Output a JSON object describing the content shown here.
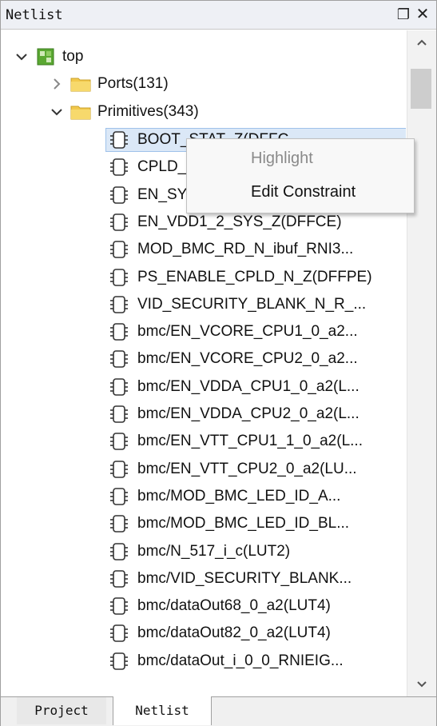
{
  "panel": {
    "title": "Netlist",
    "float_icon": "float-window-icon",
    "close_icon": "close-icon",
    "float_glyph": "❐",
    "close_glyph": "✕"
  },
  "tree": {
    "root": {
      "label": "top",
      "expanded": true
    },
    "ports": {
      "label": "Ports(131)",
      "expanded": false
    },
    "primitives": {
      "label": "Primitives(343)",
      "expanded": true
    },
    "items": [
      "BOOT_STAT_Z(DFFC",
      "CPLD_",
      "EN_SY",
      "EN_VDD1_2_SYS_Z(DFFCE)",
      "MOD_BMC_RD_N_ibuf_RNI3...",
      "PS_ENABLE_CPLD_N_Z(DFFPE)",
      "VID_SECURITY_BLANK_N_R_...",
      "bmc/EN_VCORE_CPU1_0_a2...",
      "bmc/EN_VCORE_CPU2_0_a2...",
      "bmc/EN_VDDA_CPU1_0_a2(L...",
      "bmc/EN_VDDA_CPU2_0_a2(L...",
      "bmc/EN_VTT_CPU1_1_0_a2(L...",
      "bmc/EN_VTT_CPU2_0_a2(LU...",
      "bmc/MOD_BMC_LED_ID_A...",
      "bmc/MOD_BMC_LED_ID_BL...",
      "bmc/N_517_i_c(LUT2)",
      "bmc/VID_SECURITY_BLANK...",
      "bmc/dataOut68_0_a2(LUT4)",
      "bmc/dataOut82_0_a2(LUT4)",
      "bmc/dataOut_i_0_0_RNIEIG..."
    ],
    "selected_index": 0
  },
  "context_menu": {
    "highlight_label": "Highlight",
    "edit_constraint_label": "Edit Constraint"
  },
  "tabs": {
    "project_label": "Project",
    "netlist_label": "Netlist",
    "active": "Netlist"
  },
  "colors": {
    "selection_bg": "#dbe8f7",
    "selection_border": "#9fc2ea",
    "folder_yellow": "#f2c94c",
    "top_icon_green": "#5aa832"
  }
}
